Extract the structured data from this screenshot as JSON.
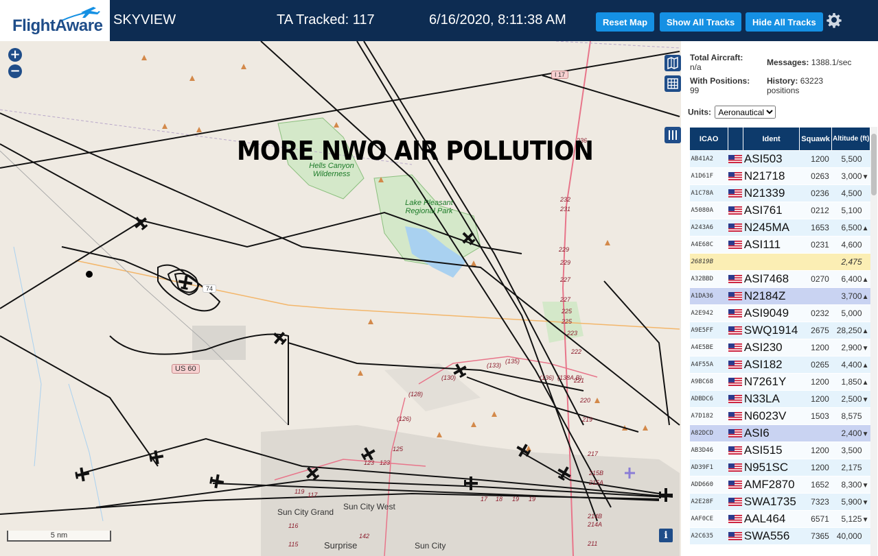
{
  "header": {
    "brand": "FlightAware",
    "app_name": "SKYVIEW",
    "tracked_label": "TA Tracked: 117",
    "datetime": "6/16/2020, 8:11:38 AM",
    "buttons": {
      "reset": "Reset Map",
      "show_all": "Show All Tracks",
      "hide_all": "Hide All Tracks"
    },
    "settings_icon": "gear-icon"
  },
  "map": {
    "overlay_text": "MORE NWO AIR POLLUTION",
    "zoom_in": "+",
    "zoom_out": "−",
    "scale_label": "5 nm",
    "info_label": "i",
    "labels": {
      "hells_canyon": "Hells Canyon Wilderness",
      "lake_pleasant": "Lake Pleasant Regional Park",
      "sun_city_grand": "Sun City Grand",
      "sun_city_west": "Sun City West",
      "surprise": "Surprise",
      "sun_city": "Sun City",
      "us60": "US 60",
      "i17": "I 17",
      "r74": "74"
    },
    "route_numbers": [
      "236",
      "232",
      "231",
      "229",
      "229",
      "227",
      "227",
      "225",
      "225",
      "223",
      "222",
      "221",
      "220",
      "219",
      "217",
      "215B",
      "215A",
      "214B",
      "214A",
      "211",
      "(135)",
      "(133)",
      "(130)",
      "(128)",
      "(126)",
      "(136)",
      "(138A,B)",
      "125",
      "123",
      "123",
      "119",
      "116",
      "115",
      "117",
      "142",
      "17",
      "18",
      "19",
      "19"
    ]
  },
  "panel": {
    "stats": {
      "total_label": "Total Aircraft:",
      "total_value": "n/a",
      "messages_label": "Messages:",
      "messages_value": "1388.1/sec",
      "positions_label": "With Positions:",
      "positions_value": "99",
      "history_label": "History:",
      "history_value": "63223 positions"
    },
    "units_label": "Units:",
    "units_value": "Aeronautical",
    "columns": {
      "icao": "ICAO",
      "ident": "Ident",
      "squawk": "Squawk",
      "altitude": "Altitude (ft)"
    },
    "rows": [
      {
        "icao": "AB41A2",
        "ident": "ASI503",
        "squawk": "1200",
        "alt": "5,500",
        "trend": "",
        "style": "r0"
      },
      {
        "icao": "A1D61F",
        "ident": "N21718",
        "squawk": "0263",
        "alt": "3,000",
        "trend": "▼",
        "style": "r1"
      },
      {
        "icao": "A1C78A",
        "ident": "N21339",
        "squawk": "0236",
        "alt": "4,500",
        "trend": "",
        "style": "r0"
      },
      {
        "icao": "A5080A",
        "ident": "ASI761",
        "squawk": "0212",
        "alt": "5,100",
        "trend": "",
        "style": "r1"
      },
      {
        "icao": "A243A6",
        "ident": "N245MA",
        "squawk": "1653",
        "alt": "6,500",
        "trend": "▲",
        "style": "r0"
      },
      {
        "icao": "A4E68C",
        "ident": "ASI111",
        "squawk": "0231",
        "alt": "4,600",
        "trend": "",
        "style": "r1"
      },
      {
        "icao": "26819B",
        "ident": "",
        "squawk": "",
        "alt": "2,475",
        "trend": "",
        "style": "rhl"
      },
      {
        "icao": "A32BBD",
        "ident": "ASI7468",
        "squawk": "0270",
        "alt": "6,400",
        "trend": "▲",
        "style": "r1"
      },
      {
        "icao": "A1DA36",
        "ident": "N2184Z",
        "squawk": "",
        "alt": "3,700",
        "trend": "▲",
        "style": "rsel"
      },
      {
        "icao": "A2E942",
        "ident": "ASI9049",
        "squawk": "0232",
        "alt": "5,000",
        "trend": "",
        "style": "r1"
      },
      {
        "icao": "A9E5FF",
        "ident": "SWQ1914",
        "squawk": "2675",
        "alt": "28,250",
        "trend": "▲",
        "style": "r0"
      },
      {
        "icao": "A4E5BE",
        "ident": "ASI230",
        "squawk": "1200",
        "alt": "2,900",
        "trend": "▼",
        "style": "r1"
      },
      {
        "icao": "A4F55A",
        "ident": "ASI182",
        "squawk": "0265",
        "alt": "4,400",
        "trend": "▲",
        "style": "r0"
      },
      {
        "icao": "A9BC68",
        "ident": "N7261Y",
        "squawk": "1200",
        "alt": "1,850",
        "trend": "▲",
        "style": "r1"
      },
      {
        "icao": "ADBDC6",
        "ident": "N33LA",
        "squawk": "1200",
        "alt": "2,500",
        "trend": "▼",
        "style": "r0"
      },
      {
        "icao": "A7D182",
        "ident": "N6023V",
        "squawk": "1503",
        "alt": "8,575",
        "trend": "",
        "style": "r1"
      },
      {
        "icao": "A82DCD",
        "ident": "ASI6",
        "squawk": "",
        "alt": "2,400",
        "trend": "▼",
        "style": "rsel"
      },
      {
        "icao": "AB3D46",
        "ident": "ASI515",
        "squawk": "1200",
        "alt": "3,500",
        "trend": "",
        "style": "r1"
      },
      {
        "icao": "AD39F1",
        "ident": "N951SC",
        "squawk": "1200",
        "alt": "2,175",
        "trend": "",
        "style": "r0"
      },
      {
        "icao": "ADD660",
        "ident": "AMF2870",
        "squawk": "1652",
        "alt": "8,300",
        "trend": "▼",
        "style": "r1"
      },
      {
        "icao": "A2E28F",
        "ident": "SWA1735",
        "squawk": "7323",
        "alt": "5,900",
        "trend": "▼",
        "style": "r0"
      },
      {
        "icao": "AAF0CE",
        "ident": "AAL464",
        "squawk": "6571",
        "alt": "5,125",
        "trend": "▼",
        "style": "r1"
      },
      {
        "icao": "A2C635",
        "ident": "SWA556",
        "squawk": "7365",
        "alt": "40,000",
        "trend": "",
        "style": "r0"
      }
    ]
  },
  "colors": {
    "header_bg": "#0d2c52",
    "button_bg": "#1590e3",
    "table_header": "#0d3a6b",
    "row_selected": "#c9d3f2",
    "row_highlight": "#fbeeb4"
  }
}
